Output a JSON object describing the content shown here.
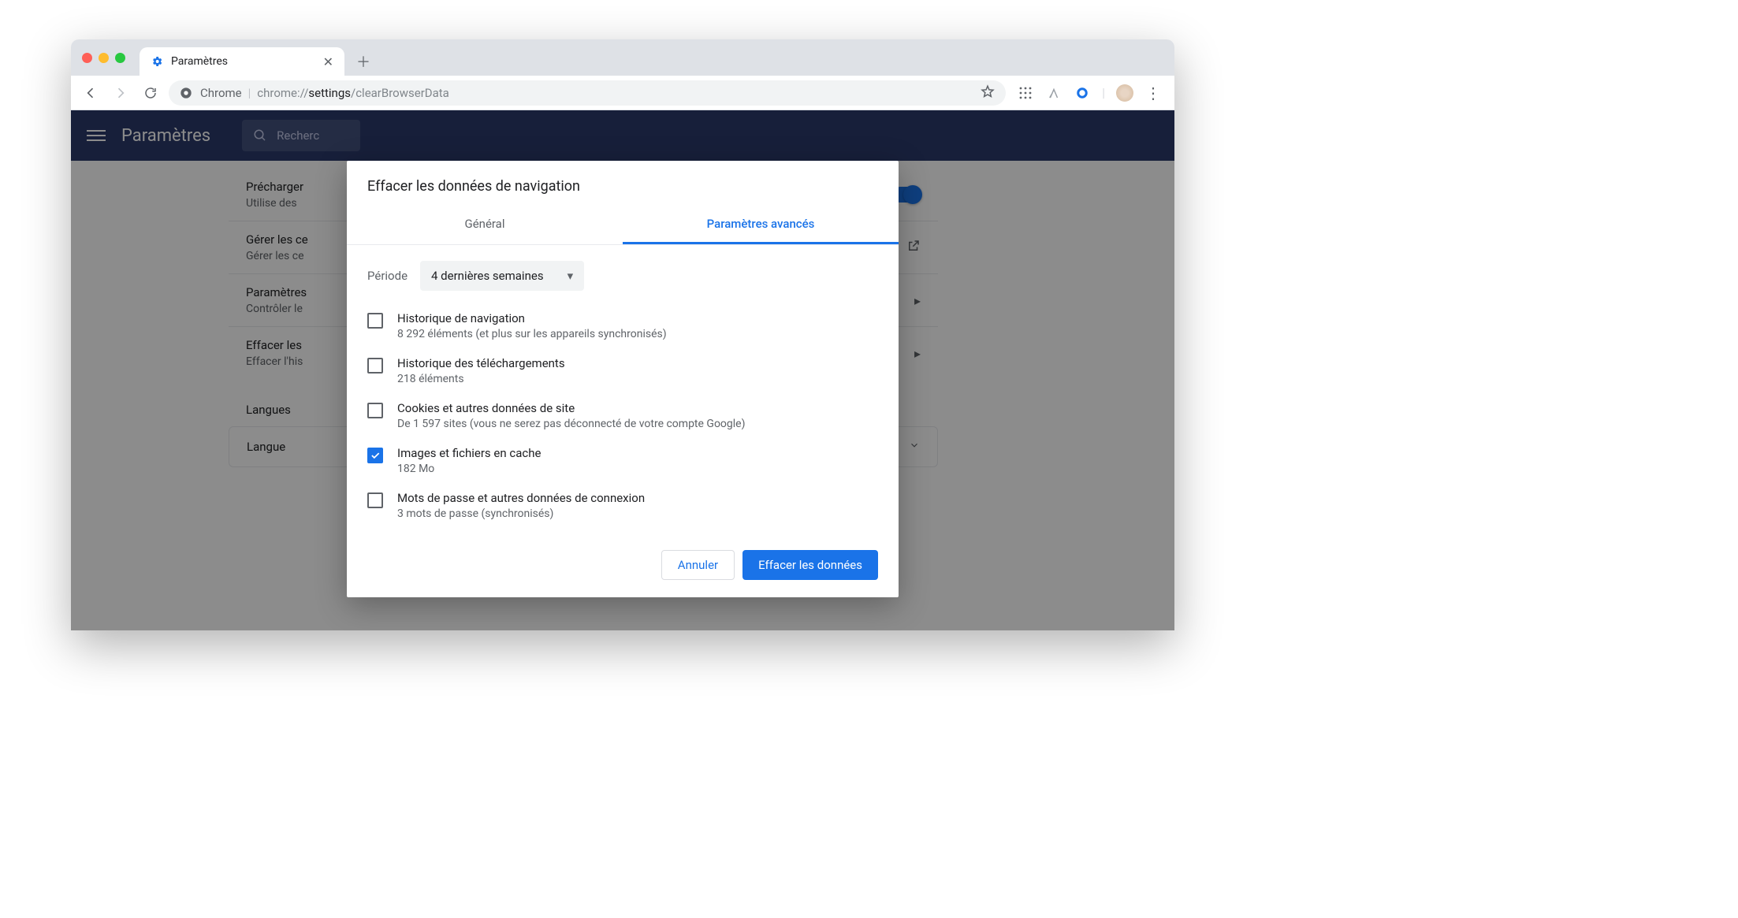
{
  "tab": {
    "title": "Paramètres"
  },
  "omnibox": {
    "prefix": "Chrome",
    "url_scheme": "chrome://",
    "url_path_bold": "settings",
    "url_path_rest": "/clearBrowserData"
  },
  "settings": {
    "title": "Paramètres",
    "search_placeholder": "Recherc",
    "rows": [
      {
        "title": "Précharger",
        "subtitle": "Utilise des"
      },
      {
        "title": "Gérer les ce",
        "subtitle": "Gérer les ce"
      },
      {
        "title": "Paramètres",
        "subtitle": "Contrôler le"
      },
      {
        "title": "Effacer les",
        "subtitle": "Effacer l'his"
      }
    ],
    "section_languages": "Langues",
    "language_row": "Langue"
  },
  "dialog": {
    "title": "Effacer les données de navigation",
    "tab_general": "Général",
    "tab_advanced": "Paramètres avancés",
    "period_label": "Période",
    "period_value": "4 dernières semaines",
    "items": [
      {
        "title": "Historique de navigation",
        "subtitle": "8 292 éléments (et plus sur les appareils synchronisés)",
        "checked": false
      },
      {
        "title": "Historique des téléchargements",
        "subtitle": "218 éléments",
        "checked": false
      },
      {
        "title": "Cookies et autres données de site",
        "subtitle": "De 1 597 sites (vous ne serez pas déconnecté de votre compte Google)",
        "checked": false
      },
      {
        "title": "Images et fichiers en cache",
        "subtitle": "182 Mo",
        "checked": true
      },
      {
        "title": "Mots de passe et autres données de connexion",
        "subtitle": "3 mots de passe (synchronisés)",
        "checked": false
      }
    ],
    "cancel": "Annuler",
    "confirm": "Effacer les données"
  }
}
